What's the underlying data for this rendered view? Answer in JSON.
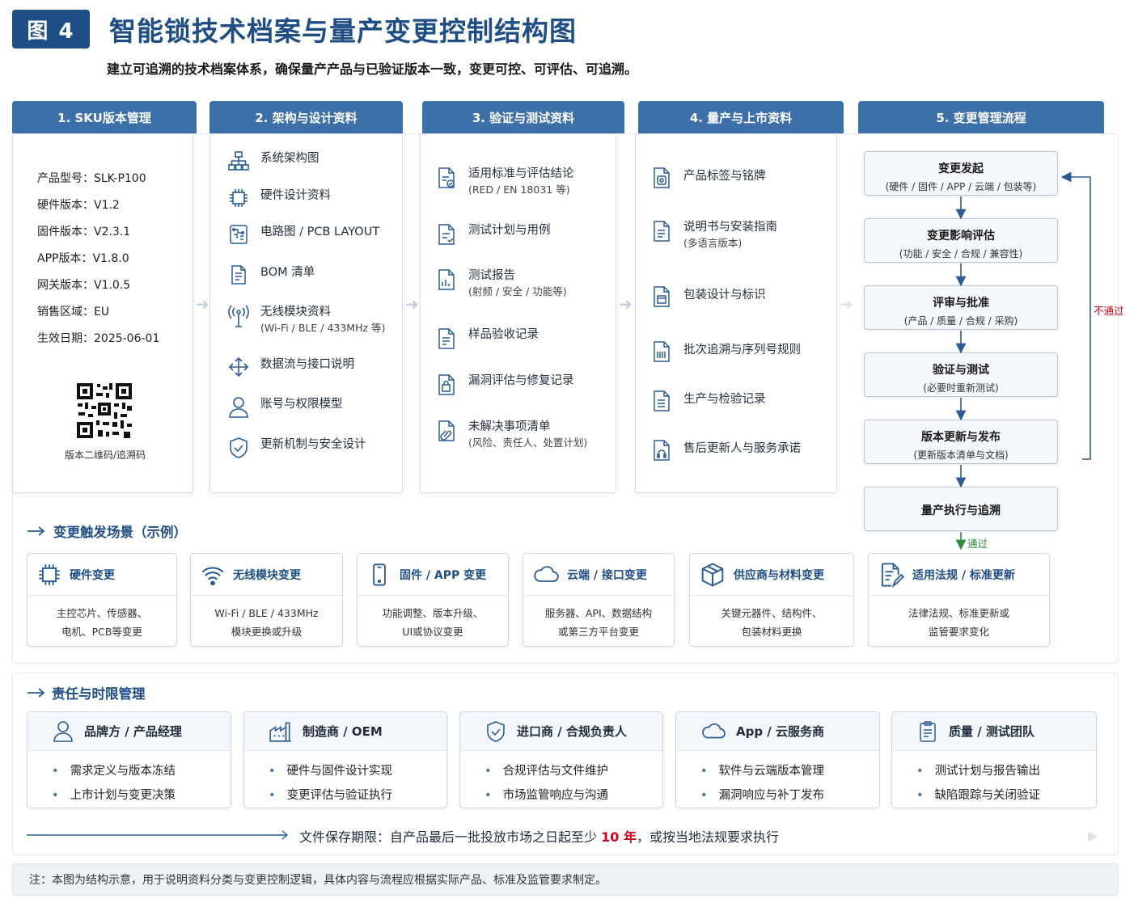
{
  "header": {
    "badge": "图 4",
    "title": "智能锁技术档案与量产变更控制结构图",
    "subtitle": "建立可追溯的技术档案体系，确保量产产品与已验证版本一致，变更可控、可评估、可追溯。"
  },
  "columns": [
    {
      "title": "1. SKU版本管理"
    },
    {
      "title": "2. 架构与设计资料"
    },
    {
      "title": "3. 验证与测试资料"
    },
    {
      "title": "4. 量产与上市资料"
    },
    {
      "title": "5. 变更管理流程"
    }
  ],
  "sku": {
    "rows": [
      "产品型号：SLK-P100",
      "硬件版本：V1.2",
      "固件版本：V2.3.1",
      "APP版本：V1.8.0",
      "网关版本：V1.0.5",
      "销售区域：EU",
      "生效日期：2025-06-01"
    ],
    "qr_caption": "版本二维码/追溯码"
  },
  "design_items": [
    {
      "icon": "hierarchy-icon",
      "label": "系统架构图"
    },
    {
      "icon": "chip-icon",
      "label": "硬件设计资料"
    },
    {
      "icon": "circuit-board-icon",
      "label": "电路图 / PCB LAYOUT"
    },
    {
      "icon": "document-list-icon",
      "label": "BOM 清单"
    },
    {
      "icon": "antenna-icon",
      "label": "无线模块资料",
      "sub": "(Wi-Fi / BLE / 433MHz 等)"
    },
    {
      "icon": "move-arrows-icon",
      "label": "数据流与接口说明"
    },
    {
      "icon": "user-icon",
      "label": "账号与权限模型"
    },
    {
      "icon": "shield-check-icon",
      "label": "更新机制与安全设计"
    }
  ],
  "test_items": [
    {
      "icon": "document-check-icon",
      "label": "适用标准与评估结论",
      "sub": "(RED / EN 18031 等)"
    },
    {
      "icon": "test-plan-icon",
      "label": "测试计划与用例"
    },
    {
      "icon": "report-icon",
      "label": "测试报告",
      "sub": "(射频 / 安全 / 功能等)"
    },
    {
      "icon": "sample-icon",
      "label": "样品验收记录"
    },
    {
      "icon": "vulnerability-icon",
      "label": "漏洞评估与修复记录"
    },
    {
      "icon": "clip-document-icon",
      "label": "未解决事项清单",
      "sub": "(风险、责任人、处置计划)"
    }
  ],
  "production_items": [
    {
      "icon": "label-icon",
      "label": "产品标签与铭牌"
    },
    {
      "icon": "manual-icon",
      "label": "说明书与安装指南",
      "sub": "(多语言版本)"
    },
    {
      "icon": "package-icon",
      "label": "包装设计与标识"
    },
    {
      "icon": "serial-icon",
      "label": "批次追溯与序列号规则"
    },
    {
      "icon": "inspection-icon",
      "label": "生产与检验记录"
    },
    {
      "icon": "service-icon",
      "label": "售后更新人与服务承诺"
    }
  ],
  "flow": {
    "steps": [
      {
        "title": "变更发起",
        "sub": "(硬件 / 固件 / APP / 云端 / 包装等)"
      },
      {
        "title": "变更影响评估",
        "sub": "(功能 / 安全 / 合规 / 兼容性)"
      },
      {
        "title": "评审与批准",
        "sub": "(产品 / 质量 / 合规 / 采购)"
      },
      {
        "title": "验证与测试",
        "sub": "(必要时重新测试)"
      },
      {
        "title": "版本更新与发布",
        "sub": "(更新版本清单与文档)"
      },
      {
        "title": "量产执行与追溯",
        "sub": ""
      }
    ],
    "fail_label": "不通过",
    "pass_label": "通过",
    "fail_color": "#d0021b",
    "pass_color": "#2e8b3a"
  },
  "scenarios": {
    "title": "变更触发场景（示例）",
    "items": [
      {
        "icon": "chip-icon",
        "title": "硬件变更",
        "lines": [
          "主控芯片、传感器、",
          "电机、PCB等变更"
        ]
      },
      {
        "icon": "wifi-icon",
        "title": "无线模块变更",
        "lines": [
          "Wi-Fi / BLE / 433MHz",
          "模块更换或升级"
        ]
      },
      {
        "icon": "phone-icon",
        "title": "固件 / APP 变更",
        "lines": [
          "功能调整、版本升级、",
          "UI或协议变更"
        ]
      },
      {
        "icon": "cloud-icon",
        "title": "云端 / 接口变更",
        "lines": [
          "服务器、API、数据结构",
          "或第三方平台变更"
        ]
      },
      {
        "icon": "box-icon",
        "title": "供应商与材料变更",
        "lines": [
          "关键元器件、结构件、",
          "包装材料更换"
        ]
      },
      {
        "icon": "law-document-icon",
        "title": "适用法规 / 标准更新",
        "lines": [
          "法律法规、标准更新或",
          "监管要求变化"
        ]
      }
    ]
  },
  "responsibility": {
    "title": "责任与时限管理",
    "items": [
      {
        "icon": "user-icon",
        "title": "品牌方 / 产品经理",
        "bullets": [
          "需求定义与版本冻结",
          "上市计划与变更决策"
        ]
      },
      {
        "icon": "factory-icon",
        "title": "制造商 / OEM",
        "bullets": [
          "硬件与固件设计实现",
          "变更评估与验证执行"
        ]
      },
      {
        "icon": "shield-check-icon",
        "title": "进口商 / 合规负责人",
        "bullets": [
          "合规评估与文件维护",
          "市场监管响应与沟通"
        ]
      },
      {
        "icon": "cloud-icon",
        "title": "App / 云服务商",
        "bullets": [
          "软件与云端版本管理",
          "漏洞响应与补丁发布"
        ]
      },
      {
        "icon": "clipboard-icon",
        "title": "质量 / 测试团队",
        "bullets": [
          "测试计划与报告输出",
          "缺陷跟踪与关闭验证"
        ]
      }
    ],
    "retention_prefix": "文件保存期限：自产品最后一批投放市场之日起至少",
    "retention_years": "10 年",
    "retention_suffix": "，或按当地法规要求执行"
  },
  "note": "注：本图为结构示意，用于说明资料分类与变更控制逻辑，具体内容与流程应根据实际产品、标准及监管要求制定。",
  "colors": {
    "brand": "#1f4e85",
    "header": "#3d6fa8",
    "highlight": "#d0021b"
  }
}
